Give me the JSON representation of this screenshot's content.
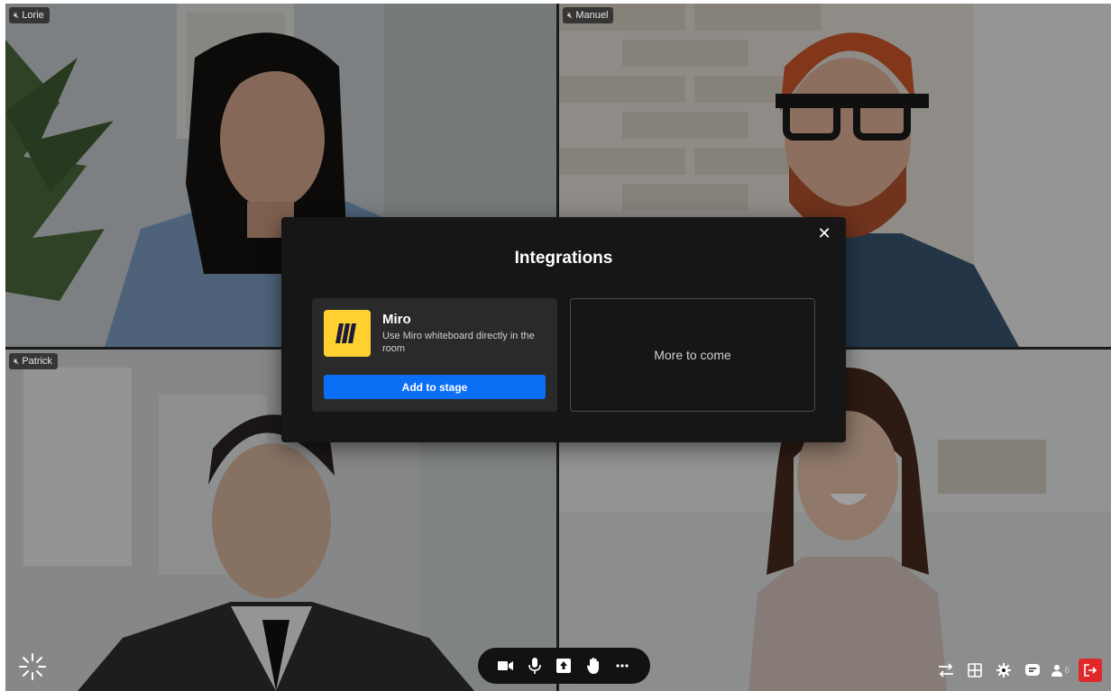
{
  "participants": [
    {
      "name": "Lorie",
      "muted_icon": "mic-off-icon"
    },
    {
      "name": "Manuel",
      "muted_icon": "mic-off-icon"
    },
    {
      "name": "Patrick",
      "muted_icon": "mic-off-icon"
    }
  ],
  "modal": {
    "title": "Integrations",
    "close_icon": "close-icon",
    "integration": {
      "name": "Miro",
      "description": "Use Miro whiteboard directly in the room",
      "button_label": "Add to stage",
      "logo_color": "#ffd02f"
    },
    "placeholder_label": "More to come"
  },
  "toolbar": {
    "center_icons": [
      "camera-icon",
      "microphone-icon",
      "share-screen-icon",
      "raise-hand-icon",
      "more-icon"
    ],
    "right_icons": [
      "switch-icon",
      "grid-layout-icon",
      "settings-icon",
      "chat-icon",
      "participants-icon"
    ],
    "participant_count": "6",
    "leave_color": "#e0282b"
  },
  "colors": {
    "accent": "#0b6ff5"
  }
}
